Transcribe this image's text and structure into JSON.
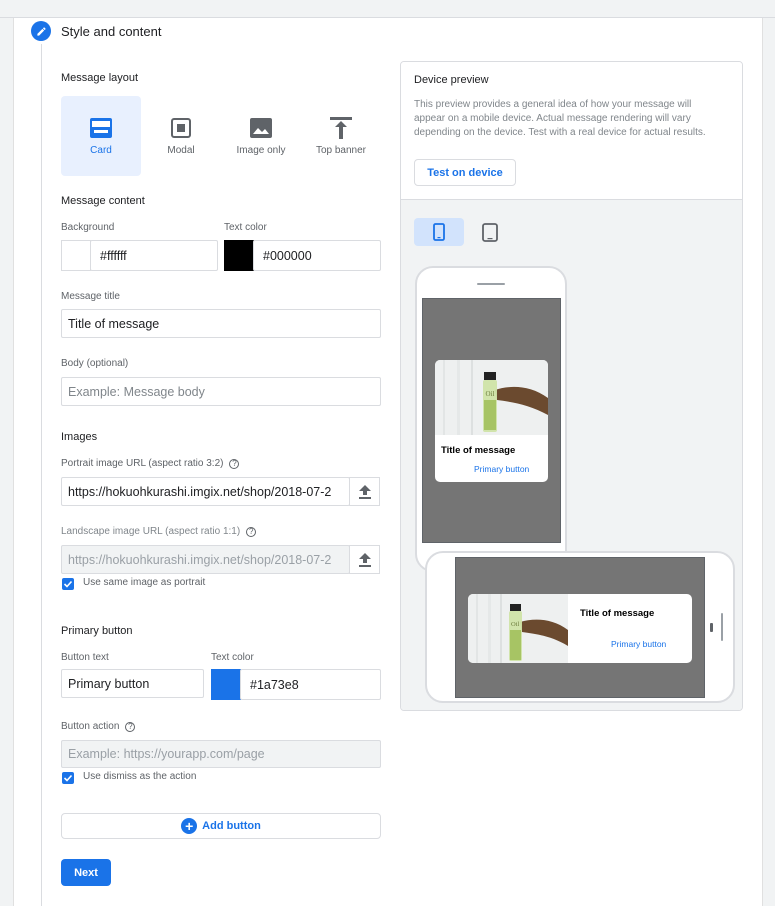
{
  "step": {
    "title": "Style and content"
  },
  "layout": {
    "label": "Message layout",
    "options": [
      {
        "name": "Card",
        "icon": "card-icon",
        "selected": true
      },
      {
        "name": "Modal",
        "icon": "modal-icon",
        "selected": false
      },
      {
        "name": "Image only",
        "icon": "image-icon",
        "selected": false
      },
      {
        "name": "Top banner",
        "icon": "top-banner-icon",
        "selected": false
      }
    ]
  },
  "content": {
    "label": "Message content",
    "background_label": "Background",
    "background_value": "#ffffff",
    "text_color_label": "Text color",
    "text_color_value": "#000000",
    "title_label": "Message title",
    "title_value": "Title of message",
    "body_label": "Body (optional)",
    "body_placeholder": "Example: Message body"
  },
  "images": {
    "label": "Images",
    "portrait_label": "Portrait image URL (aspect ratio 3:2)",
    "portrait_value": "https://hokuohkurashi.imgix.net/shop/2018-07-2",
    "landscape_label": "Landscape image URL (aspect ratio 1:1)",
    "landscape_value": "https://hokuohkurashi.imgix.net/shop/2018-07-2",
    "same_image_label": "Use same image as portrait",
    "same_image_checked": true
  },
  "primary_button": {
    "label": "Primary button",
    "text_label": "Button text",
    "text_value": "Primary button",
    "color_label": "Text color",
    "color_value": "#1a73e8",
    "action_label": "Button action",
    "action_placeholder": "Example: https://yourapp.com/page",
    "dismiss_label": "Use dismiss as the action",
    "dismiss_checked": true
  },
  "add_button_label": "Add button",
  "next_label": "Next",
  "preview": {
    "title": "Device preview",
    "description": "This preview provides a general idea of how your message will appear on a mobile device. Actual message rendering will vary depending on the device. Test with a real device for actual results.",
    "test_button": "Test on device",
    "message_title": "Title of message",
    "message_button": "Primary button"
  },
  "colors": {
    "accent": "#1a73e8",
    "background_swatch": "#ffffff",
    "text_swatch": "#000000",
    "button_text_swatch": "#1a73e8"
  }
}
